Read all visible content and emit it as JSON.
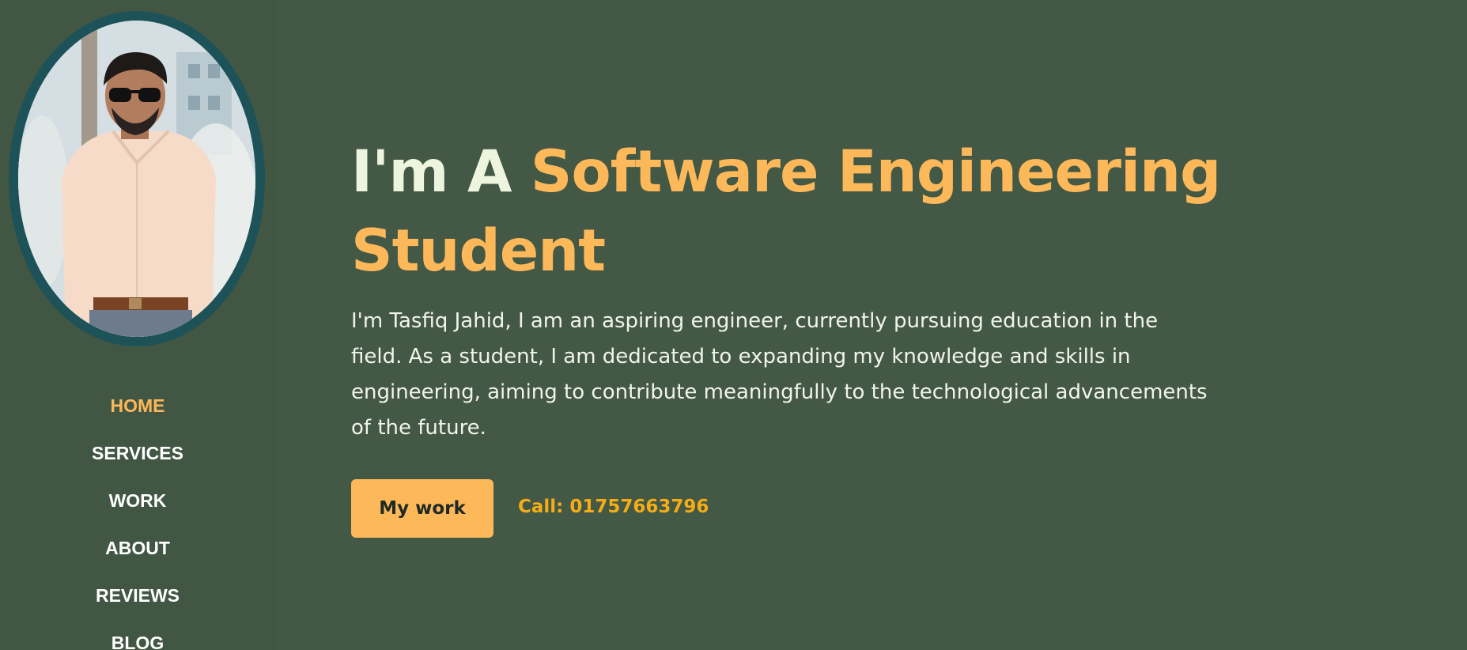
{
  "sidebar": {
    "nav": [
      {
        "label": "HOME",
        "active": true
      },
      {
        "label": "SERVICES",
        "active": false
      },
      {
        "label": "WORK",
        "active": false
      },
      {
        "label": "ABOUT",
        "active": false
      },
      {
        "label": "REVIEWS",
        "active": false
      },
      {
        "label": "BLOG",
        "active": false
      }
    ]
  },
  "hero": {
    "headline_prefix": "I'm A ",
    "headline_accent": "Software Engineering Student",
    "intro": "I'm Tasfiq Jahid, I am an aspiring engineer, currently pursuing education in the field. As a student, I am dedicated to expanding my knowledge and skills in engineering, aiming to contribute meaningfully to the technological advancements of the future.",
    "work_button_label": "My work",
    "call_text": "Call: 01757663796"
  },
  "colors": {
    "background": "#435845",
    "accent": "#fdb85a",
    "call_text": "#f4ad17",
    "avatar_ring": "#1d5258",
    "headline_light": "#edf5de"
  }
}
